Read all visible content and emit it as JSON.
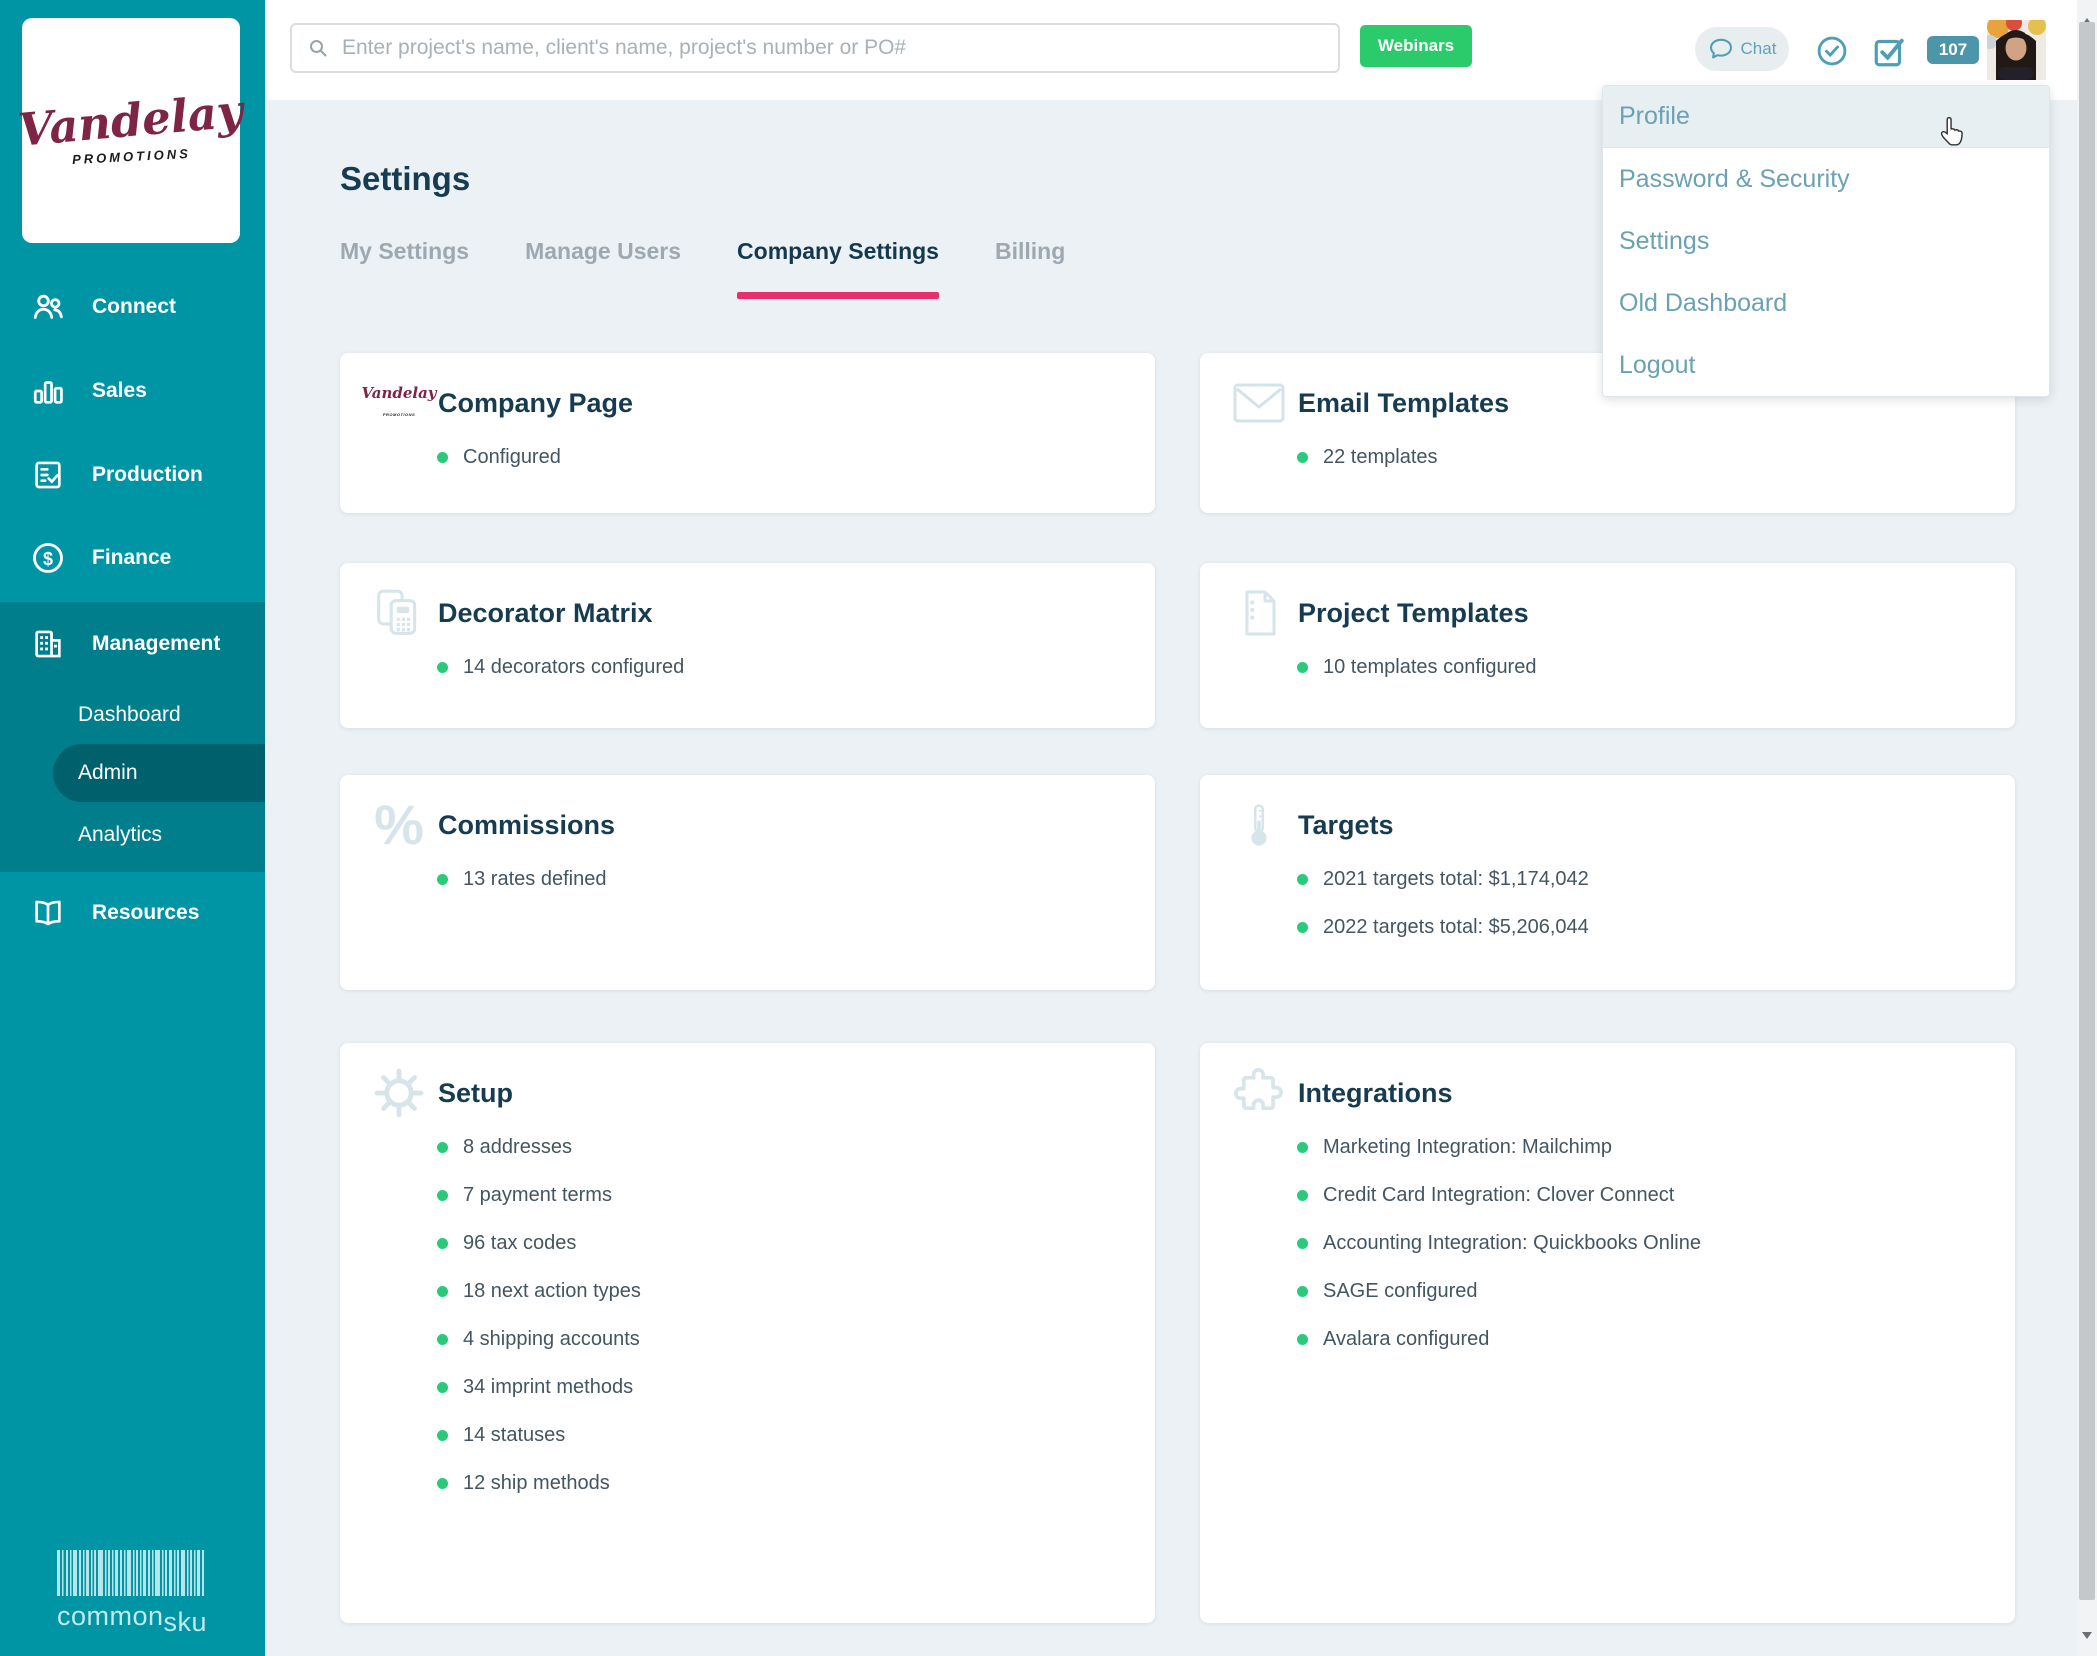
{
  "brand": {
    "logo_script": "Vandelay",
    "logo_sub": "PROMOTIONS"
  },
  "footer": {
    "logo_common": "common",
    "logo_sku": "sku"
  },
  "sidebar": {
    "items": [
      {
        "label": "Connect"
      },
      {
        "label": "Sales"
      },
      {
        "label": "Production"
      },
      {
        "label": "Finance"
      },
      {
        "label": "Management"
      },
      {
        "label": "Resources"
      }
    ],
    "management_children": [
      {
        "label": "Dashboard"
      },
      {
        "label": "Admin"
      },
      {
        "label": "Analytics"
      }
    ],
    "active_item": "Admin"
  },
  "topbar": {
    "search_placeholder": "Enter project's name, client's name, project's number or PO#",
    "webinars_label": "Webinars",
    "chat_label": "Chat",
    "notification_count": "107"
  },
  "user_menu": {
    "items": [
      {
        "label": "Profile"
      },
      {
        "label": "Password & Security"
      },
      {
        "label": "Settings"
      },
      {
        "label": "Old Dashboard"
      },
      {
        "label": "Logout"
      }
    ],
    "highlighted": "Profile"
  },
  "page": {
    "title": "Settings",
    "tabs": [
      {
        "label": "My Settings"
      },
      {
        "label": "Manage Users"
      },
      {
        "label": "Company Settings"
      },
      {
        "label": "Billing"
      }
    ],
    "active_tab": "Company Settings"
  },
  "cards": [
    {
      "title": "Company Page",
      "items": [
        "Configured"
      ]
    },
    {
      "title": "Email Templates",
      "items": [
        "22 templates"
      ]
    },
    {
      "title": "Decorator Matrix",
      "items": [
        "14 decorators configured"
      ]
    },
    {
      "title": "Project Templates",
      "items": [
        "10 templates configured"
      ]
    },
    {
      "title": "Commissions",
      "items": [
        "13 rates defined"
      ]
    },
    {
      "title": "Targets",
      "items": [
        "2021 targets total: $1,174,042",
        "2022 targets total: $5,206,044"
      ]
    },
    {
      "title": "Setup",
      "items": [
        "8 addresses",
        "7 payment terms",
        "96 tax codes",
        "18 next action types",
        "4 shipping accounts",
        "34 imprint methods",
        "14 statuses",
        "12 ship methods"
      ]
    },
    {
      "title": "Integrations",
      "items": [
        "Marketing Integration: Mailchimp",
        "Credit Card Integration: Clover Connect",
        "Accounting Integration: Quickbooks Online",
        "SAGE configured",
        "Avalara configured"
      ]
    }
  ],
  "icons": {
    "percent_glyph": "%"
  },
  "colors": {
    "sidebar_teal": "#0095A5",
    "sidebar_section_dark": "#007E8C",
    "sidebar_active_pill": "#00606C",
    "accent_teal": "#4E9EB4",
    "tab_underline_pink": "#E72F6E",
    "status_green": "#2DC97B",
    "webinars_green": "#2BCB6C",
    "title_navy": "#173B50",
    "main_background": "#EBF1F4"
  }
}
